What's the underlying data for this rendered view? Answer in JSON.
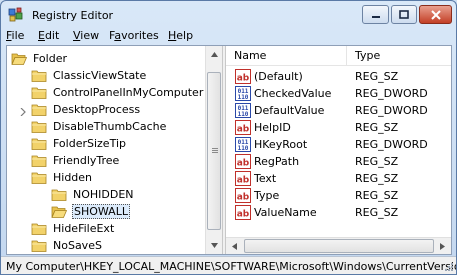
{
  "window": {
    "title": "Registry Editor"
  },
  "menu": [
    {
      "label": "File",
      "key": "F",
      "rest": "ile"
    },
    {
      "label": "Edit",
      "key": "E",
      "rest": "dit"
    },
    {
      "label": "View",
      "key": "V",
      "rest": "iew"
    },
    {
      "label": "Favorites",
      "key": "a",
      "pre": "F",
      "rest": "vorites"
    },
    {
      "label": "Help",
      "key": "H",
      "rest": "elp"
    }
  ],
  "tree": {
    "items": [
      {
        "label": "Folder",
        "level": 0,
        "expanded": true
      },
      {
        "label": "ClassicViewState",
        "level": 1
      },
      {
        "label": "ControlPanelInMyComputer",
        "level": 1
      },
      {
        "label": "DesktopProcess",
        "level": 1,
        "has_children": true
      },
      {
        "label": "DisableThumbCache",
        "level": 1
      },
      {
        "label": "FolderSizeTip",
        "level": 1
      },
      {
        "label": "FriendlyTree",
        "level": 1
      },
      {
        "label": "Hidden",
        "level": 1,
        "expanded": true
      },
      {
        "label": "NOHIDDEN",
        "level": 2
      },
      {
        "label": "SHOWALL",
        "level": 2,
        "selected": true
      },
      {
        "label": "HideFileExt",
        "level": 1
      },
      {
        "label": "NoSaveS",
        "level": 1
      }
    ]
  },
  "list": {
    "columns": {
      "name": "Name",
      "type": "Type"
    },
    "rows": [
      {
        "name": "(Default)",
        "type": "REG_SZ",
        "icon": "string-value-icon"
      },
      {
        "name": "CheckedValue",
        "type": "REG_DWORD",
        "icon": "binary-value-icon"
      },
      {
        "name": "DefaultValue",
        "type": "REG_DWORD",
        "icon": "binary-value-icon"
      },
      {
        "name": "HelpID",
        "type": "REG_SZ",
        "icon": "string-value-icon"
      },
      {
        "name": "HKeyRoot",
        "type": "REG_DWORD",
        "icon": "binary-value-icon"
      },
      {
        "name": "RegPath",
        "type": "REG_SZ",
        "icon": "string-value-icon"
      },
      {
        "name": "Text",
        "type": "REG_SZ",
        "icon": "string-value-icon"
      },
      {
        "name": "Type",
        "type": "REG_SZ",
        "icon": "string-value-icon"
      },
      {
        "name": "ValueName",
        "type": "REG_SZ",
        "icon": "string-value-icon"
      }
    ]
  },
  "status": {
    "path": "My Computer\\HKEY_LOCAL_MACHINE\\SOFTWARE\\Microsoft\\Windows\\CurrentVersion\\Explorer\\Advanced\\Folder\\Hidden\\SHOWALL"
  },
  "colors": {
    "accent": "#3b6fb6",
    "folder": "#f2d26a",
    "string_icon": "#c0302b",
    "binary_icon": "#2a48a8"
  }
}
